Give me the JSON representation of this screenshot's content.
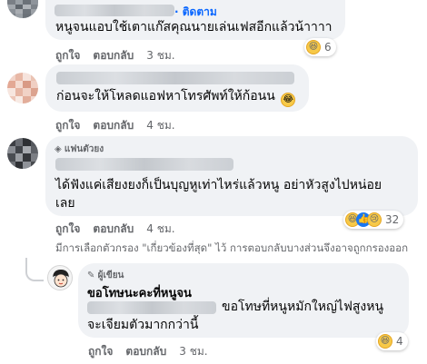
{
  "comment1": {
    "follow_label": "· ติดตาม",
    "text": "หนูจนแอบใช้เตาแก๊สคุณนายเล่นเฟสอีกแล้วน้าาาา",
    "reaction_count": "6",
    "like_label": "ถูกใจ",
    "reply_label": "ตอบกลับ",
    "time": "3 ชม."
  },
  "comment2": {
    "text": "ก่อนจะให้โหลดแอฟหาโทรศัพท์ให้ก้อนน",
    "like_label": "ถูกใจ",
    "reply_label": "ตอบกลับ",
    "time": "4 ชม."
  },
  "comment3": {
    "badge": "แฟนตัวยง",
    "text_line1": "ได้ฟังแค่เสียงยงก็เป็นบุญหูเท่าไหร่แล้วหนู อย่าหัวสูงไปหน่อย",
    "text_line2": "เลย",
    "reaction_count": "32",
    "like_label": "ถูกใจ",
    "reply_label": "ตอบกลับ",
    "time": "4 ชม."
  },
  "filter_note": "มีการเลือกตัวกรอง \"เกี่ยวข้องที่สุด\" ไว้ การตอบกลับบางส่วนจึงอาจถูกกรองออก",
  "reply": {
    "badge": "ผู้เขียน",
    "name": "ขอโทษนะคะที่หนูจน",
    "text_line1": "ขอโทษที่หนูหมักใหญ่ไฟสูงหนู",
    "text_line2": "จะเจียมตัวมากกว่านี้",
    "reaction_count": "4",
    "like_label": "ถูกใจ",
    "reply_label": "ตอบกลับ",
    "time": "3 ชม."
  },
  "colors": {
    "bubble": "#f0f2f5",
    "secondary_text": "#65676b",
    "follow_blue": "#0866ff"
  }
}
